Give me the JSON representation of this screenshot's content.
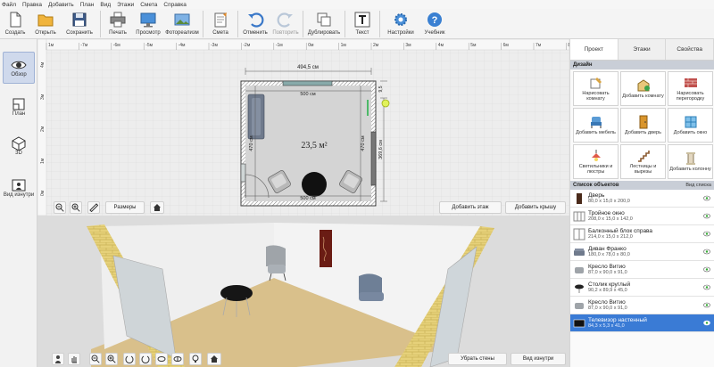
{
  "menu": [
    "Файл",
    "Правка",
    "Добавить",
    "План",
    "Вид",
    "Этажи",
    "Смета",
    "Справка"
  ],
  "toolbar": [
    {
      "id": "create",
      "label": "Создать",
      "icon": "new-file-icon"
    },
    {
      "id": "open",
      "label": "Открыть",
      "icon": "folder-icon"
    },
    {
      "id": "save",
      "label": "Сохранить",
      "icon": "floppy-icon"
    },
    {
      "id": "print",
      "label": "Печать",
      "icon": "printer-icon"
    },
    {
      "id": "preview",
      "label": "Просмотр",
      "icon": "monitor-icon"
    },
    {
      "id": "photo",
      "label": "Фотореализм",
      "icon": "photo-icon"
    },
    {
      "id": "estimate",
      "label": "Смета",
      "icon": "notepad-icon"
    },
    {
      "id": "undo",
      "label": "Отменить",
      "icon": "undo-icon"
    },
    {
      "id": "redo",
      "label": "Повторить",
      "icon": "redo-icon"
    },
    {
      "id": "duplicate",
      "label": "Дублировать",
      "icon": "duplicate-icon"
    },
    {
      "id": "text",
      "label": "Текст",
      "icon": "text-icon"
    },
    {
      "id": "settings",
      "label": "Настройки",
      "icon": "gear-icon"
    },
    {
      "id": "tutorial",
      "label": "Учебник",
      "icon": "help-icon"
    }
  ],
  "left_panel": [
    {
      "label": "Обзор",
      "active": true
    },
    {
      "label": "План"
    },
    {
      "label": "3D"
    },
    {
      "label": "Вид изнутри"
    }
  ],
  "plan": {
    "ruler_labels": [
      "1м",
      "-7м",
      "-6м",
      "-5м",
      "-4м",
      "-3м",
      "-2м",
      "-1м",
      "0м",
      "1м",
      "2м",
      "3м",
      "4м",
      "5м",
      "6м",
      "7м",
      "8м"
    ],
    "ruler_v_labels": [
      "4м",
      "3м",
      "2м",
      "1м",
      "0м",
      "-1м"
    ],
    "dim_top_outer": "494,5 см",
    "dim_top_inner": "500 см",
    "dim_bottom_inner": "500 см",
    "dim_left": "470 см",
    "dim_right_inner": "470 см",
    "dim_right_outer": "369,6 см",
    "dim_small": "9,5",
    "area": "23,5 м²",
    "sizes_button": "Размеры",
    "add_floor_button": "Добавить этаж",
    "add_roof_button": "Добавить крышу"
  },
  "view3d": {
    "remove_walls_button": "Убрать стены",
    "inside_view_button": "Вид изнутри"
  },
  "right_panel": {
    "tabs": [
      "Проект",
      "Этажи",
      "Свойства"
    ],
    "design_header": "Дизайн",
    "tiles": [
      {
        "label": "Нарисовать комнату",
        "icon": "draw-room-icon"
      },
      {
        "label": "Добавить комнату",
        "icon": "add-room-icon"
      },
      {
        "label": "Нарисовать перегородку",
        "icon": "brick-wall-icon"
      },
      {
        "label": "Добавить мебель",
        "icon": "chair-icon"
      },
      {
        "label": "Добавить дверь",
        "icon": "door-icon"
      },
      {
        "label": "Добавить окно",
        "icon": "window-icon"
      },
      {
        "label": "Светильники и люстры",
        "icon": "lamp-icon"
      },
      {
        "label": "Лестницы и вырезы",
        "icon": "stairs-icon"
      },
      {
        "label": "Добавить колонну",
        "icon": "column-icon"
      }
    ],
    "objects_header": "Список объектов",
    "view_list": "Вид списка",
    "objects": [
      {
        "name": "Дверь",
        "dims": "80,0 x 15,0 x 200,0"
      },
      {
        "name": "Тройное окно",
        "dims": "208,0 x 15,0 x 142,0"
      },
      {
        "name": "Балконный блок справа",
        "dims": "214,0 x 15,0 x 212,0"
      },
      {
        "name": "Диван Франко",
        "dims": "180,0 x 78,0 x 80,0"
      },
      {
        "name": "Кресло Витио",
        "dims": "87,0 x 90,0 x 91,0"
      },
      {
        "name": "Столик круглый",
        "dims": "90,2 x 89,9 x 45,0"
      },
      {
        "name": "Кресло Витио",
        "dims": "87,0 x 90,0 x 91,0"
      },
      {
        "name": "Телевизор настенный",
        "dims": "84,3 x 5,3 x 41,0",
        "selected": true
      }
    ]
  }
}
